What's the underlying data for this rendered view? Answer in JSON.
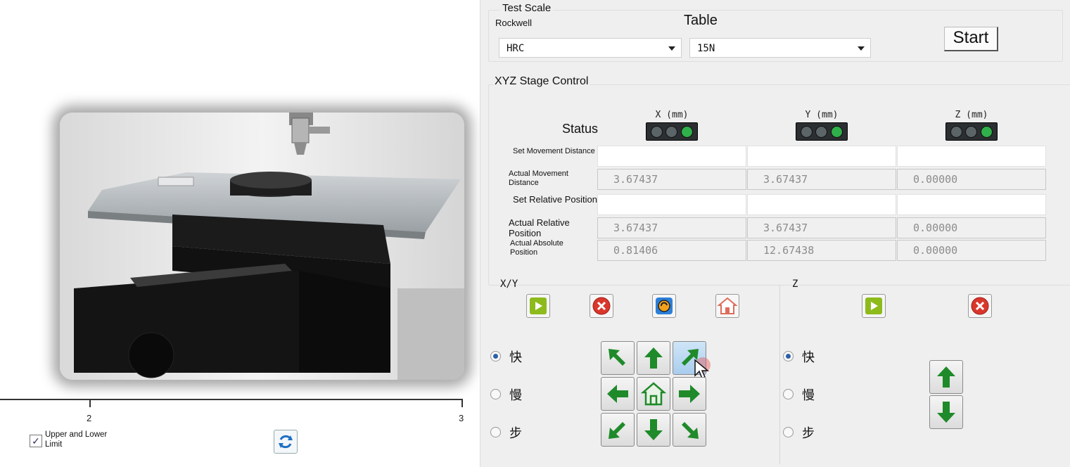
{
  "left_panel": {
    "axis": {
      "ticks": [
        "2",
        "3"
      ]
    },
    "limit_checkbox": {
      "label": "Upper and Lower Limit",
      "checked": true
    }
  },
  "test_scale": {
    "title": "Test Scale",
    "scale_label": "Rockwell",
    "table_label": "Table",
    "scale_value": "HRC",
    "table_value": "15N",
    "start_label": "Start"
  },
  "xyz": {
    "title": "XYZ Stage Control",
    "status_label": "Status",
    "columns": [
      "X (mm)",
      "Y (mm)",
      "Z (mm)"
    ],
    "row_labels": {
      "set_movement": "Set Movement Distance",
      "actual_movement": "Actual Movement Distance",
      "set_relative": "Set Relative Position",
      "actual_relative": "Actual Relative Position",
      "actual_absolute": "Actual Absolute Position"
    },
    "actual_movement": [
      "3.67437",
      "3.67437",
      "0.00000"
    ],
    "actual_relative": [
      "3.67437",
      "3.67437",
      "0.00000"
    ],
    "actual_absolute": [
      "0.81406",
      "12.67438",
      "0.00000"
    ],
    "status_colors": {
      "off": "#5b6466",
      "on": "#2fb04a"
    }
  },
  "xy_panel": {
    "title": "X/Y",
    "speeds": [
      "快",
      "慢",
      "步"
    ],
    "selected_speed": "快"
  },
  "z_panel": {
    "title": "Z",
    "speeds": [
      "快",
      "慢",
      "步"
    ],
    "selected_speed": "快"
  },
  "colors": {
    "arrow_green": "#1f8a2a",
    "start_green": "#8dbb1c",
    "stop_red": "#d9372c",
    "accent_blue": "#2c5fa8"
  }
}
